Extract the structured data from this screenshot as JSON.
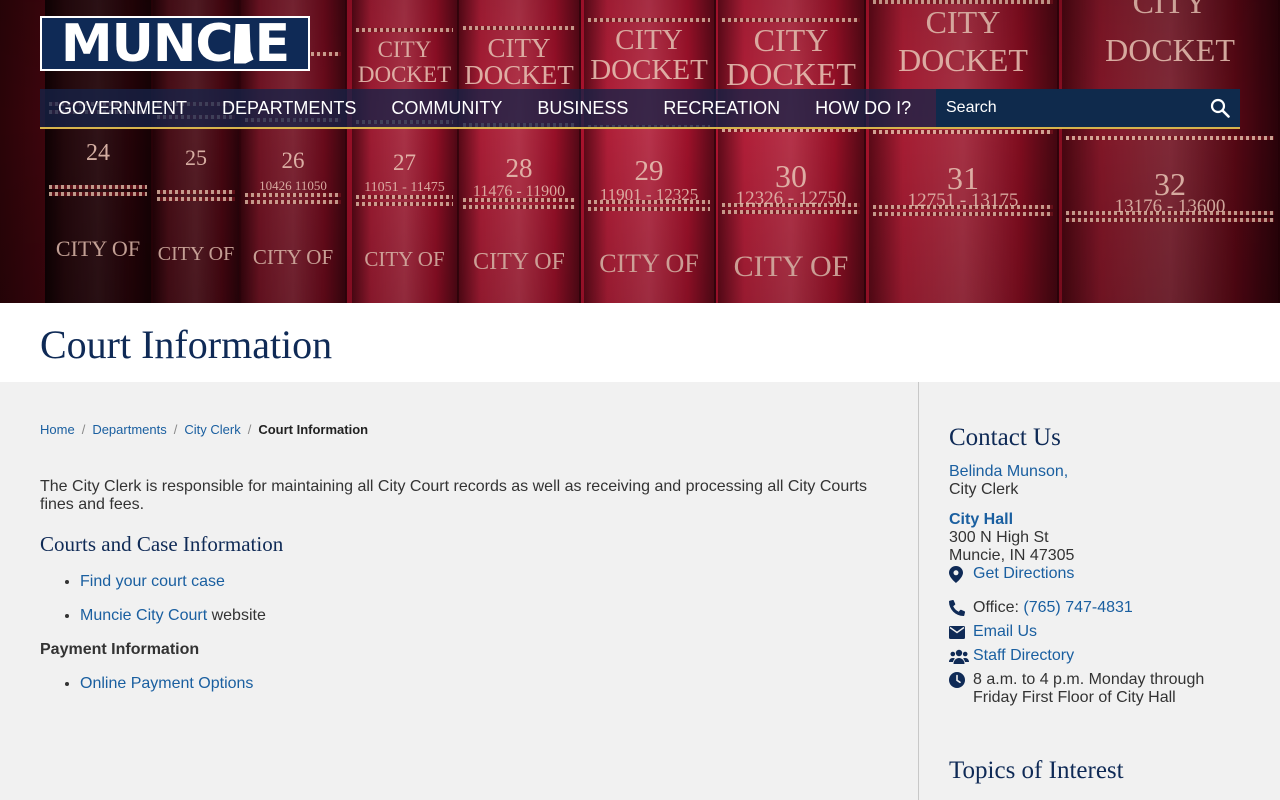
{
  "header": {
    "logo_text": "MUNCIE",
    "nav": [
      "GOVERNMENT",
      "DEPARTMENTS",
      "COMMUNITY",
      "BUSINESS",
      "RECREATION",
      "HOW DO I?"
    ],
    "search_placeholder": "Search"
  },
  "hero": {
    "books": [
      {
        "line1": "",
        "line2": "",
        "number": "24",
        "range": "",
        "city": "CITY OF"
      },
      {
        "line1": "",
        "line2": "",
        "number": "25",
        "range": "",
        "city": "CITY OF"
      },
      {
        "line1": "",
        "line2": "",
        "number": "26",
        "range": "10426 11050",
        "city": "CITY OF"
      },
      {
        "line1": "CITY",
        "line2": "DOCKET",
        "number": "27",
        "range": "11051 - 11475",
        "city": "CITY OF"
      },
      {
        "line1": "CITY",
        "line2": "DOCKET",
        "number": "28",
        "range": "11476 - 11900",
        "city": "CITY OF"
      },
      {
        "line1": "CITY",
        "line2": "DOCKET",
        "number": "29",
        "range": "11901 - 12325",
        "city": "CITY OF"
      },
      {
        "line1": "CITY",
        "line2": "DOCKET",
        "number": "30",
        "range": "12326 - 12750",
        "city": "CITY OF"
      },
      {
        "line1": "CITY",
        "line2": "DOCKET",
        "number": "31",
        "range": "12751 - 13175",
        "city": ""
      },
      {
        "line1": "CITY",
        "line2": "DOCKET",
        "number": "32",
        "range": "13176 - 13600",
        "city": ""
      }
    ]
  },
  "page": {
    "title": "Court Information"
  },
  "breadcrumb": {
    "items": [
      "Home",
      "Departments",
      "City Clerk"
    ],
    "current": "Court Information"
  },
  "main": {
    "intro": "The City Clerk is responsible for maintaining all City Court records as well as receiving and processing all City Courts fines and fees.",
    "courts_heading": "Courts and Case Information",
    "courts_links": {
      "find_case": "Find your court case",
      "city_court": "Muncie City Court",
      "city_court_suffix": " website"
    },
    "payment_heading": "Payment Information",
    "payment_link": "Online Payment Options"
  },
  "sidebar": {
    "contact_heading": "Contact Us",
    "contact_name": "Belinda Munson,",
    "contact_role": "City Clerk",
    "location_name": "City Hall",
    "address1": "300 N High St",
    "address2": "Muncie, IN 47305",
    "directions": "Get Directions",
    "office_label": "Office: ",
    "office_phone": "(765) 747-4831",
    "email": "Email Us",
    "staff": "Staff Directory",
    "hours": "8 a.m. to 4 p.m. Monday through Friday First Floor of City Hall",
    "topics_heading": "Topics of Interest"
  },
  "colors": {
    "brand_navy": "#0f2a56",
    "link_blue": "#1a5fa0",
    "nav_gold": "#d7b44c",
    "page_bg": "#f1f1f1"
  },
  "icons": {
    "search": "search-icon",
    "directions": "map-marker-icon",
    "phone": "phone-icon",
    "email": "envelope-icon",
    "staff": "users-icon",
    "hours": "clock-icon"
  }
}
